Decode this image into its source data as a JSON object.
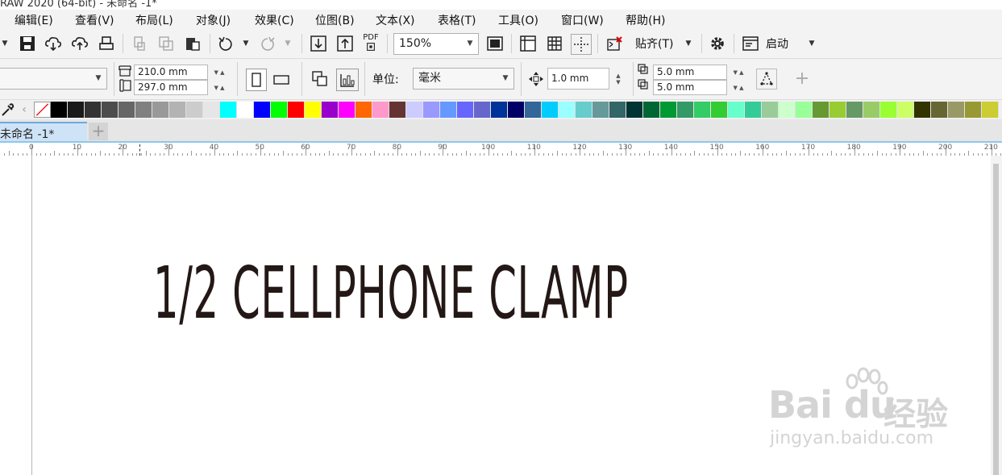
{
  "window": {
    "title_fragment": "RAW 2020 (64-bit) - 未命名 -1*"
  },
  "menu": [
    {
      "label": "编辑(E)"
    },
    {
      "label": "查看(V)"
    },
    {
      "label": "布局(L)"
    },
    {
      "label": "对象(J)"
    },
    {
      "label": "效果(C)"
    },
    {
      "label": "位图(B)"
    },
    {
      "label": "文本(X)"
    },
    {
      "label": "表格(T)"
    },
    {
      "label": "工具(O)"
    },
    {
      "label": "窗口(W)"
    },
    {
      "label": "帮助(H)"
    }
  ],
  "toolbar": {
    "zoom_value": "150%",
    "pdf_label": "PDF",
    "snap_label": "贴齐(T)",
    "launch_label": "启动"
  },
  "property_bar": {
    "page_width": "210.0 mm",
    "page_height": "297.0 mm",
    "units_label": "单位:",
    "units_value": "毫米",
    "nudge_value": "1.0 mm",
    "dup_x": "5.0 mm",
    "dup_y": "5.0 mm"
  },
  "palette": {
    "colors": [
      "#000000",
      "#1a1a1a",
      "#333333",
      "#4d4d4d",
      "#666666",
      "#808080",
      "#999999",
      "#b3b3b3",
      "#cccccc",
      "#e6e6e6",
      "#00ffff",
      "#ffffff",
      "#0000ff",
      "#00ff00",
      "#ff0000",
      "#ffff00",
      "#9900cc",
      "#ff00ff",
      "#ff6600",
      "#ff99cc",
      "#663333",
      "#ccccff",
      "#9999ff",
      "#6699ff",
      "#6666ff",
      "#6666cc",
      "#003399",
      "#000066",
      "#336699",
      "#00ccff",
      "#99ffff",
      "#66cccc",
      "#669999",
      "#336666",
      "#003333",
      "#006633",
      "#009933",
      "#339966",
      "#33cc66",
      "#33cc33",
      "#66ffcc",
      "#33cc99",
      "#99cc99",
      "#ccffcc",
      "#99ff99",
      "#669933",
      "#99cc33",
      "#669966",
      "#99cc66",
      "#99ff33",
      "#ccff66",
      "#333300",
      "#666633",
      "#999966",
      "#999933",
      "#cccc33"
    ]
  },
  "document": {
    "tab_label": "未命名 -1*"
  },
  "ruler": {
    "labels": [
      "0",
      "10",
      "20",
      "30",
      "40",
      "50",
      "60",
      "70",
      "80",
      "90",
      "100",
      "110",
      "120",
      "130",
      "140",
      "150",
      "160",
      "170",
      "180",
      "190",
      "200",
      "210"
    ]
  },
  "canvas": {
    "headline": "1/2 CELLPHONE CLAMP"
  },
  "watermark": {
    "logo": "Bai du",
    "cn": "经验",
    "url": "jingyan.baidu.com"
  }
}
